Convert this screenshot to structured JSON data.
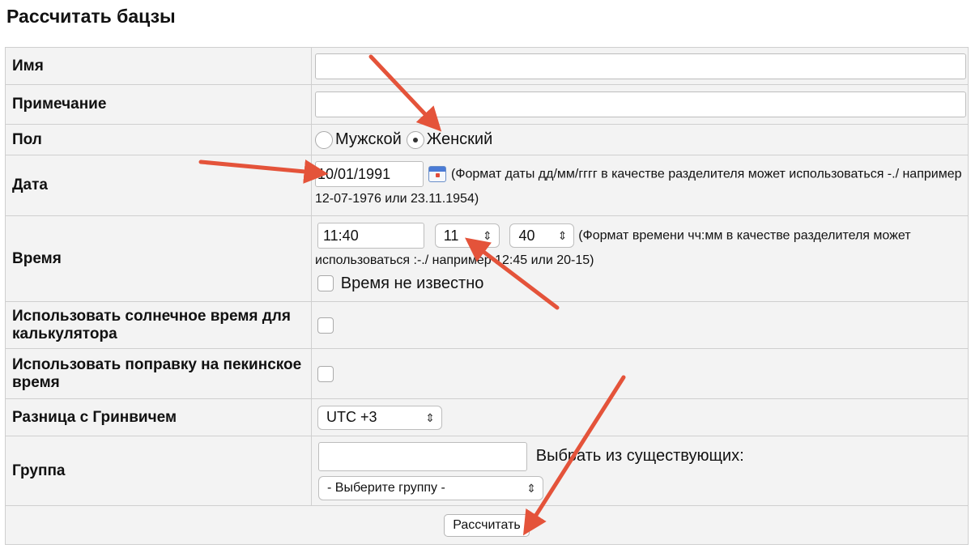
{
  "page": {
    "title": "Рассчитать бацзы"
  },
  "form": {
    "name": {
      "label": "Имя",
      "value": ""
    },
    "note": {
      "label": "Примечание",
      "value": ""
    },
    "gender": {
      "label": "Пол",
      "options": [
        "Мужской",
        "Женский"
      ],
      "selected": "Женский"
    },
    "date": {
      "label": "Дата",
      "value": "10/01/1991",
      "hint": "(Формат даты дд/мм/гггг в качестве разделителя может использоваться -./ например 12-07-1976 или 23.11.1954)"
    },
    "time": {
      "label": "Время",
      "value": "11:40",
      "hour": "11",
      "minute": "40",
      "hint": "(Формат времени чч:мм в качестве разделителя может использоваться :-./ например 12:45 или 20-15)",
      "unknown_label": "Время не известно",
      "unknown_checked": false
    },
    "solar": {
      "label": "Использовать солнечное время для калькулятора",
      "checked": false
    },
    "beijing": {
      "label": "Использовать поправку на пекинское время",
      "checked": false
    },
    "utc": {
      "label": "Разница с Гринвичем",
      "value": "UTC +3"
    },
    "group": {
      "label": "Группа",
      "value": "",
      "existing_label": "Выбрать из существующих:",
      "select_value": "- Выберите группу -"
    },
    "submit_label": "Рассчитать"
  },
  "colors": {
    "annotation_arrow": "#e4533a",
    "row_bg": "#f3f3f3",
    "border": "#cfcfcf"
  }
}
